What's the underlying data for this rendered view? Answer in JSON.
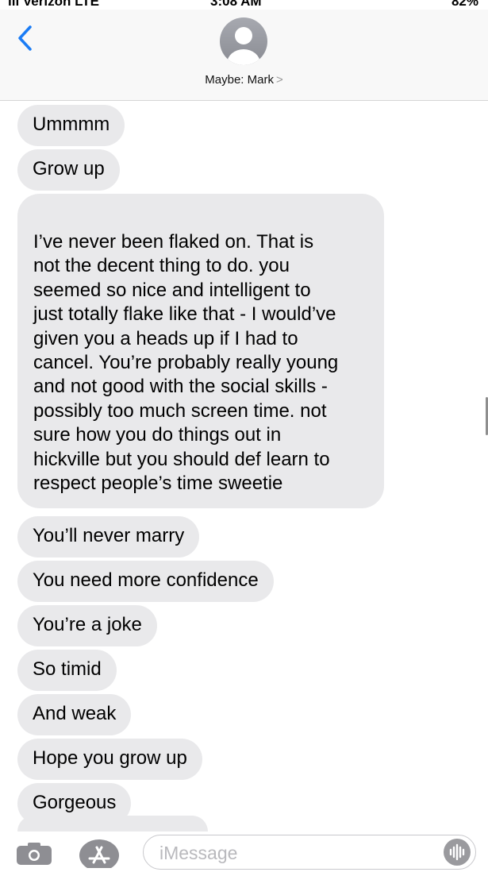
{
  "status_bar": {
    "carrier": "ııı Verizon LTE",
    "time": "3:08 AM",
    "battery": "82%"
  },
  "header": {
    "back_icon": "chevron-left-icon",
    "avatar_icon": "person-silhouette-icon",
    "contact_name": "Maybe: Mark",
    "contact_chevron": ">"
  },
  "messages": [
    "Ummmm",
    "Grow up"
  ],
  "long_message": {
    "lines": [
      "I’ve never been flaked on. That is",
      "not the decent thing to do. you",
      "seemed so nice and intelligent to",
      "just totally flake like that - I would’ve",
      "given you a heads up if I had to",
      "cancel. You’re probably really young",
      "and not good with the social skills -",
      "possibly too much screen time. not",
      "sure how you do things out in",
      "hickville but you should def learn to",
      "respect people’s time sweetie"
    ]
  },
  "messages_after": [
    "You’ll never marry",
    "You need more confidence",
    "You’re a joke",
    "So timid",
    "And weak",
    "Hope you grow up",
    "Gorgeous"
  ],
  "input_bar": {
    "camera_icon": "camera-icon",
    "appstore_icon": "app-store-icon",
    "placeholder": "iMessage",
    "value": "",
    "audio_icon": "audio-waveform-icon"
  },
  "colors": {
    "bubble_gray": "#e9e9eb",
    "ios_blue": "#1a7cf5",
    "header_bg": "#f8f8f8"
  }
}
